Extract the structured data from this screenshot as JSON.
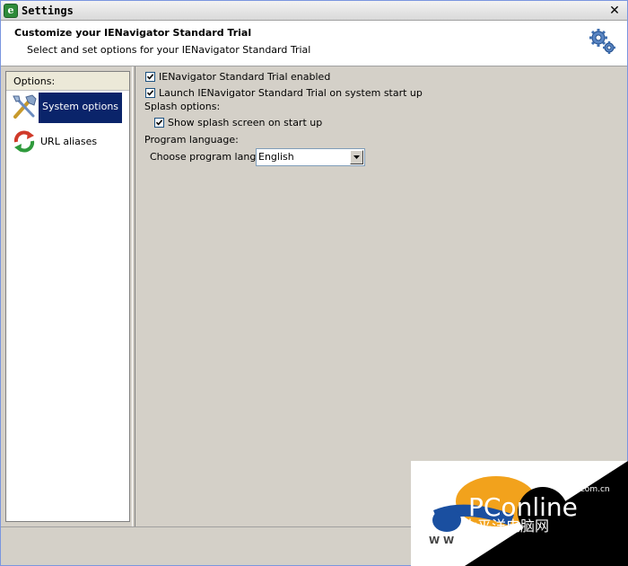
{
  "window": {
    "title": "Settings",
    "app_icon_glyph": "e",
    "close_glyph": "✕"
  },
  "header": {
    "title": "Customize your IENavigator Standard Trial",
    "subtitle": "Select and set options for your IENavigator Standard Trial",
    "icon": "gears-icon"
  },
  "sidebar": {
    "heading": "Options:",
    "items": [
      {
        "label": "System options",
        "icon": "tools-icon",
        "selected": true
      },
      {
        "label": "URL aliases",
        "icon": "refresh-arrows-icon",
        "selected": false
      }
    ]
  },
  "system_options": {
    "enabled_label": "IENavigator Standard Trial enabled",
    "enabled_checked": true,
    "launch_label": "Launch IENavigator Standard Trial on system start up",
    "launch_checked": true,
    "splash_heading": "Splash options:",
    "splash_label": "Show splash screen on start up",
    "splash_checked": true,
    "language_heading": "Program language:",
    "language_label": "Choose program language:",
    "language_value": "English"
  },
  "watermark": {
    "brand": "PConline",
    "domain": ".com.cn",
    "chinese": "太平洋电脑网",
    "www": "W W"
  },
  "colors": {
    "selection": "#0a246a",
    "window_bg": "#d4d0c8"
  }
}
